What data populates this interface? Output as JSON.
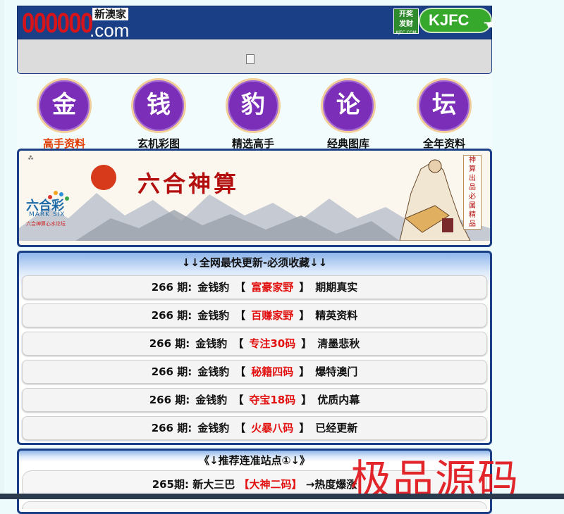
{
  "header": {
    "logo_number": "000000",
    "logo_suffix": ".com",
    "logo_cn": "新澳家",
    "kjfc_box_line1": "开奖",
    "kjfc_box_line2": "发财",
    "kjfc_box_line3": "KJFC.COM",
    "kjfc_button": "KJFC"
  },
  "nav": [
    {
      "char": "金",
      "label": "高手资料",
      "color": "#e23b00"
    },
    {
      "char": "钱",
      "label": "玄机彩图"
    },
    {
      "char": "豹",
      "label": "精选高手"
    },
    {
      "char": "论",
      "label": "经典图库"
    },
    {
      "char": "坛",
      "label": "全年资料"
    }
  ],
  "banner": {
    "title": "六合神算",
    "mark_cn": "六合彩",
    "mark_en": "MARK SIX",
    "mark_sub": "六合神算心水论坛",
    "side_text": [
      "神",
      "算",
      "出",
      "品",
      "必",
      "属",
      "精",
      "品"
    ]
  },
  "panel1": {
    "title": "↓↓全网最快更新-必须收藏↓↓",
    "rows": [
      {
        "period": "266 期:",
        "name": "金钱豹",
        "open": "【",
        "hl": "富豪家野",
        "close": "】",
        "tail": "期期真实"
      },
      {
        "period": "266 期:",
        "name": "金钱豹",
        "open": "【",
        "hl": "百赚家野",
        "close": "】",
        "tail": "精英资料"
      },
      {
        "period": "266 期:",
        "name": "金钱豹",
        "open": "【",
        "hl": "专注30码",
        "close": "】",
        "tail": "清墨悲秋"
      },
      {
        "period": "266 期:",
        "name": "金钱豹",
        "open": "【",
        "hl": "秘籍四码",
        "close": "】",
        "tail": "爆特澳门"
      },
      {
        "period": "266 期:",
        "name": "金钱豹",
        "open": "【",
        "hl": "夺宝18码",
        "close": "】",
        "tail": "优质内幕"
      },
      {
        "period": "266 期:",
        "name": "金钱豹",
        "open": "【",
        "hl": "火暴八码",
        "close": "】",
        "tail": "已经更新"
      }
    ]
  },
  "panel2": {
    "title": "《↓推荐连准站点①↓》",
    "row": {
      "period": "265期:",
      "name": "新大三巴",
      "hl": "【大神二码】",
      "tail": "→热度爆涨"
    }
  },
  "watermark": "极品源码"
}
